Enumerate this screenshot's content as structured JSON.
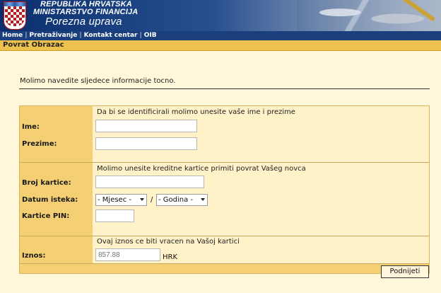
{
  "header": {
    "line1": "REPUBLIKA HRVATSKA",
    "line2": "MINISTARSTVO FINANCIJA",
    "line3": "Porezna uprava"
  },
  "nav": {
    "items": [
      "Home",
      "Pretraživanje",
      "Kontakt centar",
      "OIB"
    ],
    "separator": "|"
  },
  "page": {
    "title": "Povrat Obrazac",
    "intro": "Molimo navedite sljedece informacije tocno."
  },
  "form": {
    "section1": {
      "hint": "Da bi se identificirali molimo unesite vaše ime i prezime",
      "first_name_label": "Ime:",
      "first_name_value": "",
      "last_name_label": "Prezime:",
      "last_name_value": ""
    },
    "section2": {
      "hint": "Molimo unesite kreditne kartice primiti povrat Vašeg novca",
      "card_number_label": "Broj kartice:",
      "card_number_value": "",
      "expiry_label": "Datum isteka:",
      "month_selected": "- Mjesec -",
      "date_separator": "/",
      "year_selected": "- Godina -",
      "pin_label": "Kartice PIN:",
      "pin_value": ""
    },
    "section3": {
      "hint": "Ovaj iznos ce biti vracen na Vašoj kartici",
      "amount_label": "Iznos:",
      "amount_placeholder": "857.88",
      "currency": "HRK"
    },
    "submit_label": "Podnijeti"
  },
  "colors": {
    "panel": "#f4cf73",
    "panel_light": "#fff2c8",
    "page_bg": "#fff7d9",
    "nav_bg": "#1a3f7c",
    "title_band": "#ecc14e"
  }
}
